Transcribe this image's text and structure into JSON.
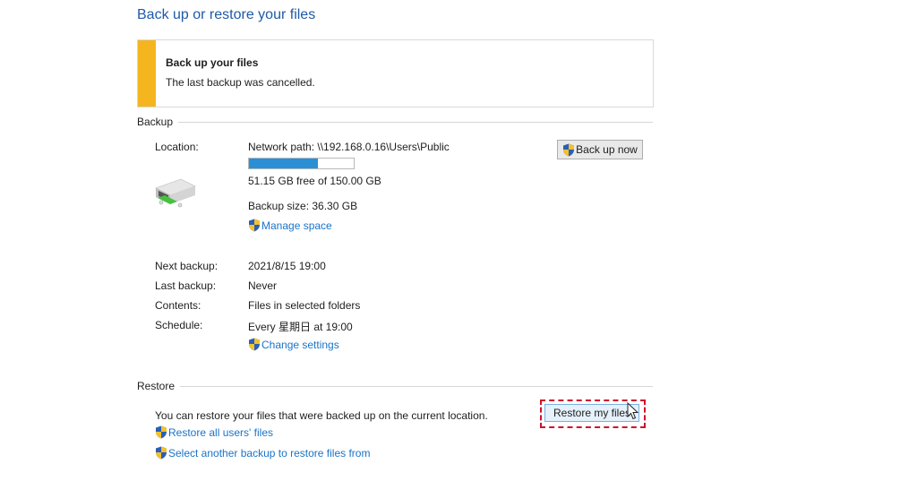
{
  "page": {
    "title": "Back up or restore your files"
  },
  "notice": {
    "heading": "Back up your files",
    "message": "The last backup was cancelled.",
    "accent_color": "#f4b51e"
  },
  "backup": {
    "section_label": "Backup",
    "location_label": "Location:",
    "location_value": "Network path: \\\\192.168.0.16\\Users\\Public",
    "usage_fraction": 0.659,
    "free_space": "51.15 GB free of 150.00 GB",
    "backup_size": "Backup size: 36.30 GB",
    "manage_space_link": "Manage space",
    "back_up_now_button": "Back up now",
    "details": [
      {
        "label": "Next backup:",
        "value": "2021/8/15 19:00"
      },
      {
        "label": "Last backup:",
        "value": "Never"
      },
      {
        "label": "Contents:",
        "value": "Files in selected folders"
      },
      {
        "label": "Schedule:",
        "value": "Every 星期日 at 19:00"
      }
    ],
    "change_settings_link": "Change settings"
  },
  "restore": {
    "section_label": "Restore",
    "description": "You can restore your files that were backed up on the current location.",
    "restore_all_link": "Restore all users' files",
    "select_another_link": "Select another backup to restore files from",
    "restore_button": "Restore my files",
    "highlight_color": "#d0112b"
  },
  "colors": {
    "link": "#1a73c8",
    "title": "#1e5aa8",
    "progress": "#2b8fd6"
  }
}
